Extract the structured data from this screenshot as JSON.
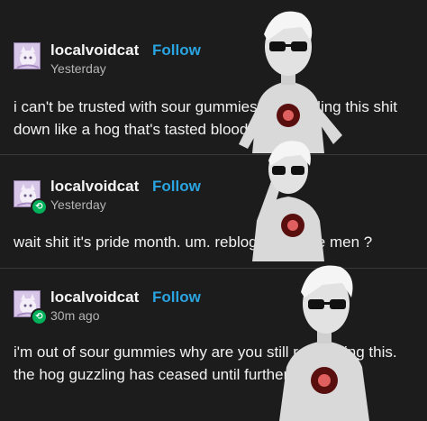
{
  "posts": [
    {
      "username": "localvoidcat",
      "follow_label": "Follow",
      "timestamp": "Yesterday",
      "reblogged": false,
      "text": "i can't be trusted with sour gummies i'm guzzling this shit down like a hog that's tasted blood"
    },
    {
      "username": "localvoidcat",
      "follow_label": "Follow",
      "timestamp": "Yesterday",
      "reblogged": true,
      "text": "wait shit it's pride month. um. reblog if you like men ?"
    },
    {
      "username": "localvoidcat",
      "follow_label": "Follow",
      "timestamp": "30m ago",
      "reblogged": true,
      "text": "i'm out of sour gummies why are you still reblogging this. the hog guzzling has ceased until further notice"
    }
  ],
  "colors": {
    "background": "#1c1c1c",
    "follow": "#2aa4e0",
    "reblog": "#00b05a"
  },
  "icons": [
    "avatar-cat-icon",
    "reblog-icon"
  ]
}
